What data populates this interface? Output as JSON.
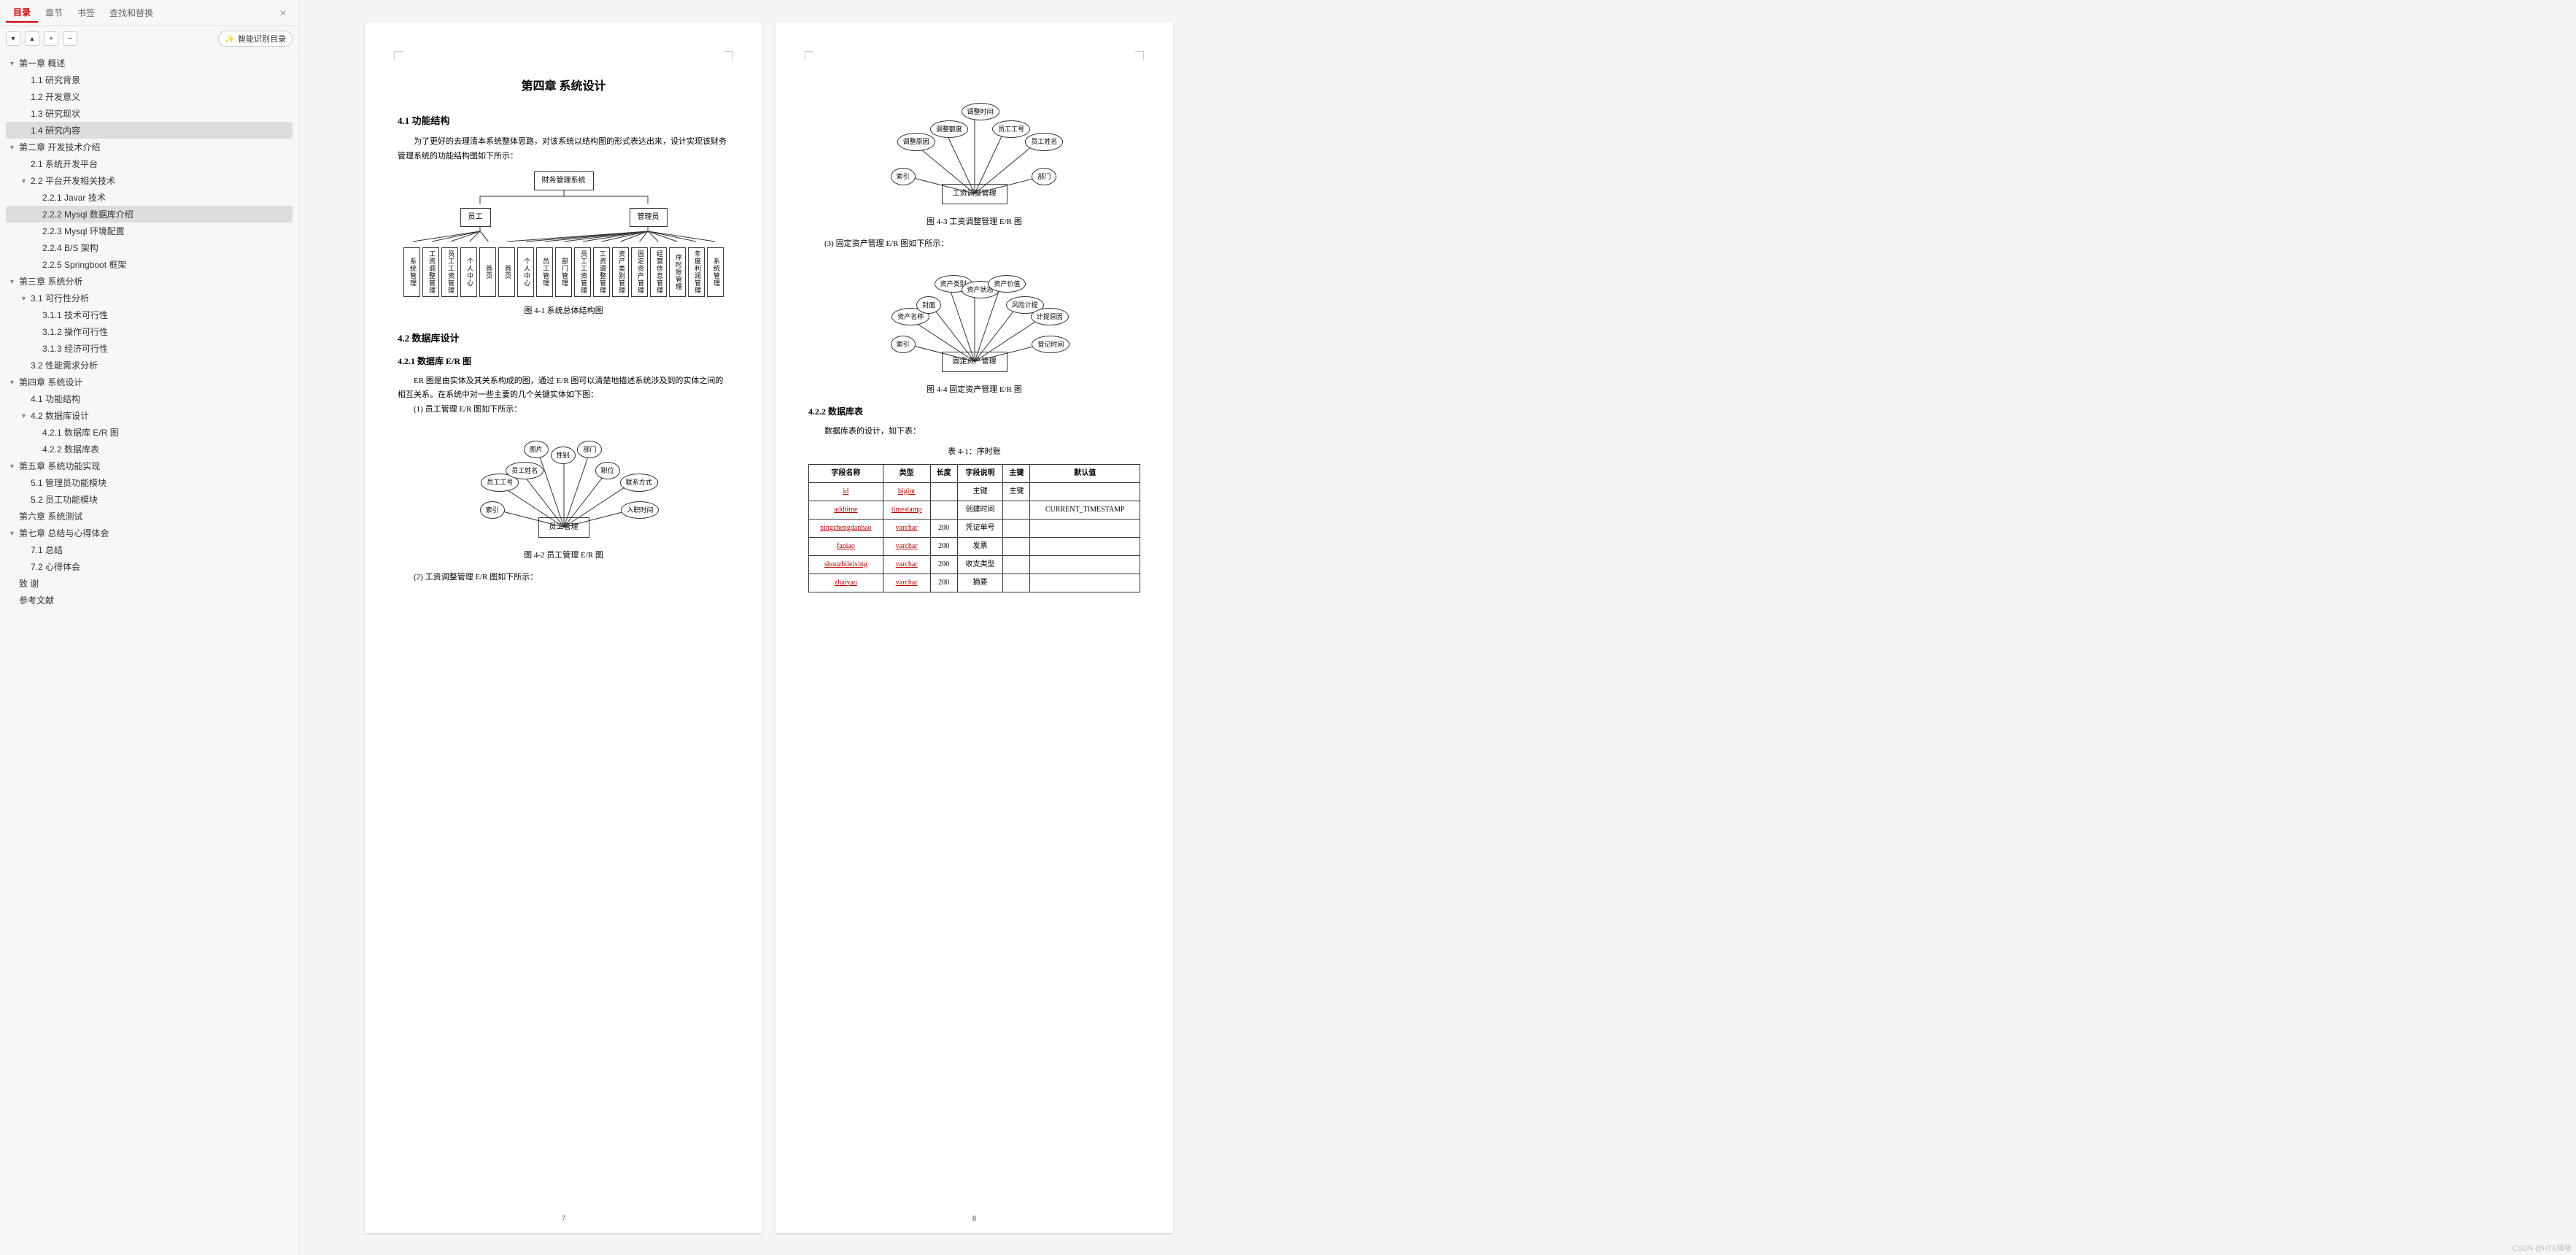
{
  "tabs": {
    "toc": "目录",
    "chapter": "章节",
    "bookmark": "书签",
    "findreplace": "查找和替换"
  },
  "smart_toc": "智能识别目录",
  "toc": [
    {
      "lv": 0,
      "arrow": true,
      "t": "第一章  概述"
    },
    {
      "lv": 1,
      "t": "1.1 研究背景"
    },
    {
      "lv": 1,
      "t": "1.2 开发意义"
    },
    {
      "lv": 1,
      "t": "1.3 研究现状"
    },
    {
      "lv": 1,
      "t": "1.4 研究内容",
      "sel": true
    },
    {
      "lv": 0,
      "arrow": true,
      "t": "第二章  开发技术介绍"
    },
    {
      "lv": 1,
      "t": "2.1  系统开发平台"
    },
    {
      "lv": 1,
      "arrow": true,
      "t": "2.2  平台开发相关技术"
    },
    {
      "lv": 2,
      "t": "2.2.1   Javar 技术"
    },
    {
      "lv": 2,
      "t": "2.2.2   Mysql 数据库介绍",
      "sel": true
    },
    {
      "lv": 2,
      "t": "2.2.3   Mysql 环境配置"
    },
    {
      "lv": 2,
      "t": "2.2.4   B/S 架构"
    },
    {
      "lv": 2,
      "t": "2.2.5   Springboot 框架"
    },
    {
      "lv": 0,
      "arrow": true,
      "t": "第三章  系统分析"
    },
    {
      "lv": 1,
      "arrow": true,
      "t": "3.1  可行性分析"
    },
    {
      "lv": 2,
      "t": "3.1.1  技术可行性"
    },
    {
      "lv": 2,
      "t": "3.1.2 操作可行性"
    },
    {
      "lv": 2,
      "t": "3.1.3 经济可行性"
    },
    {
      "lv": 1,
      "t": "3.2 性能需求分析"
    },
    {
      "lv": 0,
      "arrow": true,
      "t": "第四章  系统设计"
    },
    {
      "lv": 1,
      "t": "4.1 功能结构"
    },
    {
      "lv": 1,
      "arrow": true,
      "t": "4.2  数据库设计"
    },
    {
      "lv": 2,
      "t": "4.2.1  数据库 E/R 图"
    },
    {
      "lv": 2,
      "t": "4.2.2  数据库表"
    },
    {
      "lv": 0,
      "arrow": true,
      "t": "第五章  系统功能实现"
    },
    {
      "lv": 1,
      "t": "5.1 管理员功能模块"
    },
    {
      "lv": 1,
      "t": "5.2 员工功能模块"
    },
    {
      "lv": 0,
      "t": "第六章  系统测试"
    },
    {
      "lv": 0,
      "arrow": true,
      "t": "第七章  总结与心得体会"
    },
    {
      "lv": 1,
      "t": "7.1 总结"
    },
    {
      "lv": 1,
      "t": "7.2 心得体会"
    },
    {
      "lv": 0,
      "t": "致    谢"
    },
    {
      "lv": 0,
      "t": "参考文献"
    }
  ],
  "page7": {
    "num": "7",
    "chapter": "第四章  系统设计",
    "s41": "4.1 功能结构",
    "p41": "为了更好的去理清本系统整体思路，对该系统以结构图的形式表达出来，设计实现该财务管理系统的功能结构图如下所示：",
    "tree_root": "财务管理系统",
    "tree_mid": [
      "员工",
      "管理员"
    ],
    "tree_leaves_left": [
      "系统管理",
      "工资调整管理",
      "员工工资管理",
      "个人中心",
      "首页"
    ],
    "tree_leaves_right": [
      "首页",
      "个人中心",
      "员工管理",
      "部门管理",
      "员工工资管理",
      "工资调整管理",
      "资产类别管理",
      "固定资产管理",
      "经营信息管理",
      "序时账管理",
      "年度利润管理",
      "系统管理"
    ],
    "fig41": "图 4-1  系统总体结构图",
    "s42": "4.2  数据库设计",
    "s421": "4.2.1  数据库 E/R 图",
    "p42": "ER 图是由实体及其关系构成的图，通过 E/R 图可以清楚地描述系统涉及到的实体之间的相互关系。在系统中对一些主要的几个关键实体如下图：",
    "p42a": "(1) 员工管理 E/R 图如下所示：",
    "er1_center": "员工管理",
    "er1_nodes": [
      "索引",
      "员工工号",
      "员工姓名",
      "图片",
      "性别",
      "部门",
      "职位",
      "联系方式",
      "入职时间"
    ],
    "fig42": "图 4-2 员工管理 E/R 图",
    "p42b": "(2) 工资调整管理 E/R 图如下所示："
  },
  "page8": {
    "num": "8",
    "er2_center": "工资调整管理",
    "er2_nodes": [
      "索引",
      "调整原因",
      "调整额度",
      "调整时间",
      "员工工号",
      "员工姓名",
      "部门"
    ],
    "fig43": "图 4-3 工资调整管理 E/R 图",
    "p43": "(3) 固定资产管理 E/R 图如下所示：",
    "er3_center": "固定资产管理",
    "er3_nodes": [
      "索引",
      "资产名称",
      "封面",
      "资产类别",
      "资产状态",
      "资产价值",
      "风险计提",
      "计提原因",
      "登记时间"
    ],
    "fig44": "图 4-4 固定资产管理 E/R 图",
    "s422": "4.2.2  数据库表",
    "p44": "数据库表的设计，如下表：",
    "table_caption": "表 4-1：序时账",
    "th": [
      "字段名称",
      "类型",
      "长度",
      "字段说明",
      "主键",
      "默认值"
    ],
    "rows": [
      [
        "id",
        "bigint",
        "",
        "主键",
        "主键",
        ""
      ],
      [
        "addtime",
        "timestamp",
        "",
        "创建时间",
        "",
        "CURRENT_TIMESTAMP"
      ],
      [
        "pingzhengdanhao",
        "varchar",
        "200",
        "凭证单号",
        "",
        ""
      ],
      [
        "fapiao",
        "varchar",
        "200",
        "发票",
        "",
        ""
      ],
      [
        "shouzhileixing",
        "varchar",
        "200",
        "收支类型",
        "",
        ""
      ],
      [
        "zhaiyao",
        "varchar",
        "200",
        "摘要",
        "",
        ""
      ]
    ]
  },
  "chart_data": [
    {
      "type": "table",
      "title": "表 4-1：序时账",
      "columns": [
        "字段名称",
        "类型",
        "长度",
        "字段说明",
        "主键",
        "默认值"
      ],
      "rows": [
        [
          "id",
          "bigint",
          "",
          "主键",
          "主键",
          ""
        ],
        [
          "addtime",
          "timestamp",
          "",
          "创建时间",
          "",
          "CURRENT_TIMESTAMP"
        ],
        [
          "pingzhengdanhao",
          "varchar",
          "200",
          "凭证单号",
          "",
          ""
        ],
        [
          "fapiao",
          "varchar",
          "200",
          "发票",
          "",
          ""
        ],
        [
          "shouzhileixing",
          "varchar",
          "200",
          "收支类型",
          "",
          ""
        ],
        [
          "zhaiyao",
          "varchar",
          "200",
          "摘要",
          "",
          ""
        ]
      ]
    }
  ],
  "watermark": "CSDN @HTE模极"
}
